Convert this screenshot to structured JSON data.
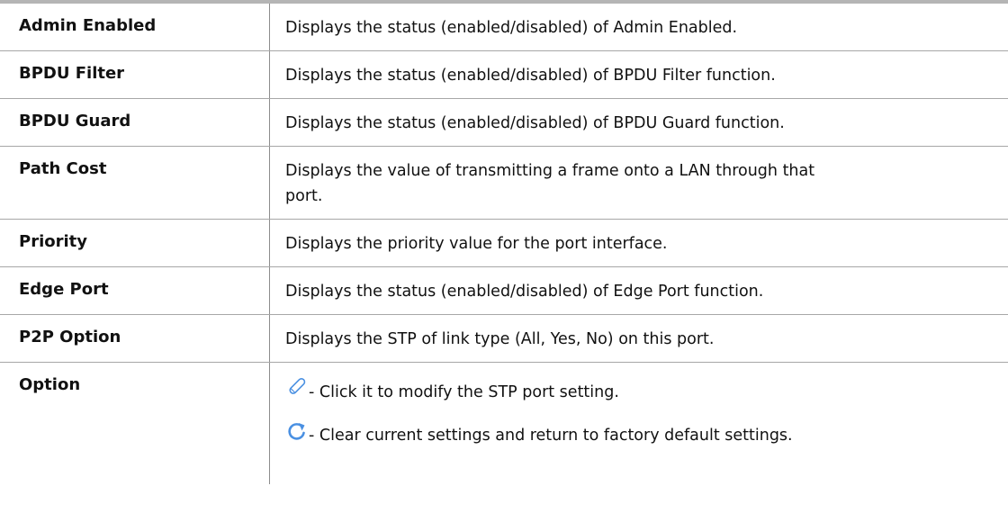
{
  "table": {
    "rows": [
      {
        "term": "Admin Enabled",
        "description": "Displays the status (enabled/disabled) of Admin Enabled."
      },
      {
        "term": "BPDU Filter",
        "description": "Displays the status (enabled/disabled) of BPDU Filter function."
      },
      {
        "term": "BPDU Guard",
        "description": "Displays the status (enabled/disabled) of BPDU Guard function."
      },
      {
        "term": "Path Cost",
        "description_line1": "Displays the value of transmitting a frame onto a LAN through that",
        "description_line2": "port."
      },
      {
        "term": "Priority",
        "description": "Displays the priority value for the port interface."
      },
      {
        "term": "Edge Port",
        "description": "Displays the status (enabled/disabled) of Edge Port function."
      },
      {
        "term": "P2P Option",
        "description": "Displays the STP of link type (All, Yes, No) on this port."
      },
      {
        "term": "Option",
        "options": [
          {
            "icon": "pencil-edit-icon",
            "text": "- Click it to modify the STP port setting."
          },
          {
            "icon": "refresh-reset-icon",
            "text": "- Clear current settings and return to factory default settings."
          }
        ]
      }
    ]
  },
  "colors": {
    "icon_blue": "#4a90e2",
    "border_gray": "#a7a7a7",
    "top_rule": "#b5b5b5"
  }
}
